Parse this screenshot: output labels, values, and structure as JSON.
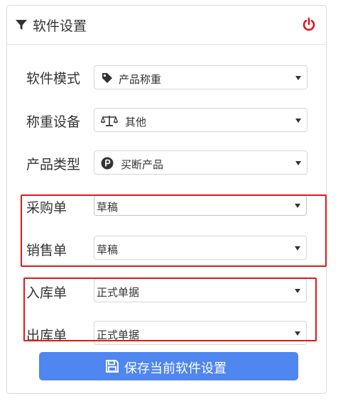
{
  "panel": {
    "title": "软件设置",
    "filter_icon": "filter-icon",
    "power_icon": "power-icon",
    "power_color": "#e01818"
  },
  "fields": {
    "software_mode": {
      "label": "软件模式",
      "value": "产品称重",
      "icon": "tag-icon"
    },
    "weighing_device": {
      "label": "称重设备",
      "value": "其他",
      "icon": "scale-icon"
    },
    "product_type": {
      "label": "产品类型",
      "value": "买断产品",
      "icon": "p-circle-icon"
    },
    "purchase_order": {
      "label": "采购单",
      "value": "草稿"
    },
    "sales_order": {
      "label": "销售单",
      "value": "草稿"
    },
    "stock_in": {
      "label": "入库单",
      "value": "正式单据"
    },
    "stock_out": {
      "label": "出库单",
      "value": "正式单据"
    }
  },
  "save_button": {
    "label": "保存当前软件设置",
    "icon": "floppy-disk-icon",
    "color": "#4f86f0"
  },
  "highlight_color": "#e01818"
}
